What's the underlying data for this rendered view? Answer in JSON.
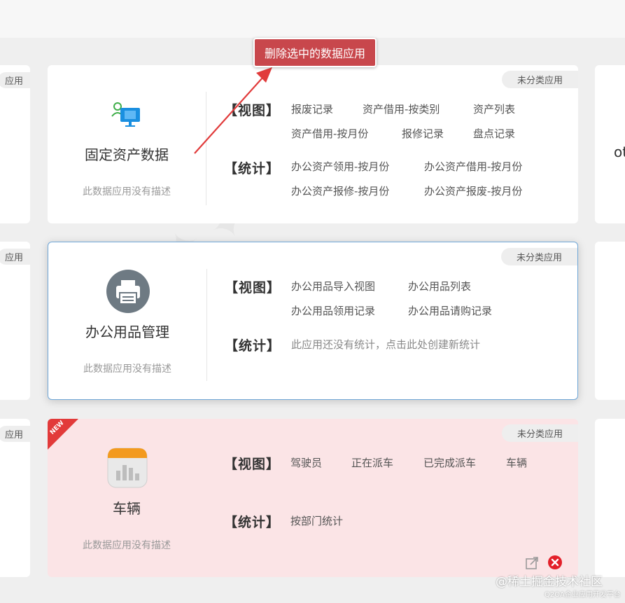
{
  "tooltip": {
    "label": "删除选中的数据应用"
  },
  "side": {
    "left_tag": "应用",
    "right_label": "ot"
  },
  "cards": [
    {
      "tag": "未分类应用",
      "title": "固定资产数据",
      "desc": "此数据应用没有描述",
      "views_label": "【视图】",
      "views": [
        "报废记录",
        "资产借用-按类别",
        "资产列表",
        "资产借用-按月份",
        "报修记录",
        "盘点记录"
      ],
      "stats_label": "【统计】",
      "stats": [
        "办公资产领用-按月份",
        "办公资产借用-按月份",
        "办公资产报修-按月份",
        "办公资产报废-按月份"
      ]
    },
    {
      "tag": "未分类应用",
      "title": "办公用品管理",
      "desc": "此数据应用没有描述",
      "views_label": "【视图】",
      "views": [
        "办公用品导入视图",
        "办公用品列表",
        "办公用品领用记录",
        "办公用品请购记录"
      ],
      "stats_label": "【统计】",
      "stats_empty": "此应用还没有统计，点击此处创建新统计"
    },
    {
      "tag": "未分类应用",
      "badge": "NEW",
      "title": "车辆",
      "desc": "此数据应用没有描述",
      "views_label": "【视图】",
      "views": [
        "驾驶员",
        "正在派车",
        "已完成派车",
        "车辆"
      ],
      "stats_label": "【统计】",
      "stats": [
        "按部门统计"
      ]
    }
  ],
  "footer": {
    "brand": "@稀土掘金技术社区",
    "sub": "Q2OA企业应用开发平台"
  },
  "colors": {
    "tooltip_bg": "#c8474c",
    "selected_border": "#6fa7d8",
    "new_card_bg": "#fbe4e6"
  }
}
